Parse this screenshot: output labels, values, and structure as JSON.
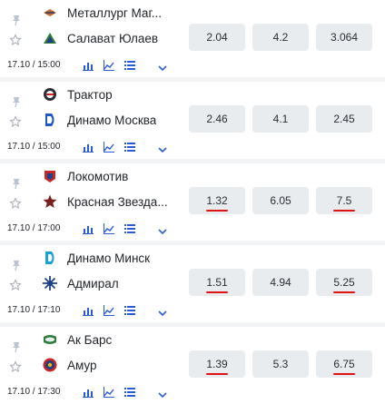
{
  "matches": [
    {
      "home": {
        "name": "Металлург Маг...",
        "logo": "metallurg-logo"
      },
      "away": {
        "name": "Салават Юлаев",
        "logo": "salavat-logo"
      },
      "time": "17.10 / 15:00",
      "odds": [
        {
          "value": "2.04",
          "underlined": false
        },
        {
          "value": "4.2",
          "underlined": false
        },
        {
          "value": "3.064",
          "underlined": false
        }
      ]
    },
    {
      "home": {
        "name": "Трактор",
        "logo": "traktor-logo"
      },
      "away": {
        "name": "Динамо Москва",
        "logo": "dinamo-moscow-logo"
      },
      "time": "17.10 / 15:00",
      "odds": [
        {
          "value": "2.46",
          "underlined": false
        },
        {
          "value": "4.1",
          "underlined": false
        },
        {
          "value": "2.45",
          "underlined": false
        }
      ]
    },
    {
      "home": {
        "name": "Локомотив",
        "logo": "lokomotiv-logo"
      },
      "away": {
        "name": "Красная Звезда...",
        "logo": "red-star-logo"
      },
      "time": "17.10 / 17:00",
      "odds": [
        {
          "value": "1.32",
          "underlined": true
        },
        {
          "value": "6.05",
          "underlined": false
        },
        {
          "value": "7.5",
          "underlined": true
        }
      ]
    },
    {
      "home": {
        "name": "Динамо Минск",
        "logo": "dinamo-minsk-logo"
      },
      "away": {
        "name": "Адмирал",
        "logo": "admiral-logo"
      },
      "time": "17.10 / 17:10",
      "odds": [
        {
          "value": "1.51",
          "underlined": true
        },
        {
          "value": "4.94",
          "underlined": false
        },
        {
          "value": "5.25",
          "underlined": true
        }
      ]
    },
    {
      "home": {
        "name": "Ак Барс",
        "logo": "ak-bars-logo"
      },
      "away": {
        "name": "Амур",
        "logo": "amur-logo"
      },
      "time": "17.10 / 17:30",
      "odds": [
        {
          "value": "1.39",
          "underlined": true
        },
        {
          "value": "5.3",
          "underlined": false
        },
        {
          "value": "6.75",
          "underlined": true
        }
      ]
    }
  ],
  "icons": {
    "pin": "pin-icon",
    "favorite": "star-icon",
    "stats": "bar-chart-icon",
    "trend": "trend-chart-icon",
    "list": "list-icon",
    "expand": "chevron-down-icon"
  },
  "colors": {
    "accent_underline": "#e01313",
    "odd_background": "#e9ecef",
    "row_background": "#ffffff",
    "page_background": "#f2f3f5",
    "icon_blue": "#2a5bd7"
  }
}
